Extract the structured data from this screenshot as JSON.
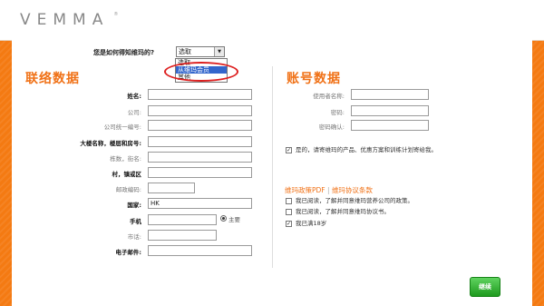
{
  "brand": {
    "logo_text": "VEMMA",
    "logo_mark": "®"
  },
  "question": {
    "label": "您是如何得知维玛的?",
    "selected": "选取",
    "options": [
      "选取",
      "从维玛会员",
      "其他"
    ],
    "highlighted_option": "从维玛会员"
  },
  "contact": {
    "title": "联络数据",
    "fields": [
      {
        "label": "姓名:",
        "value": ""
      },
      {
        "label": "公司:",
        "value": ""
      },
      {
        "label": "公司统一编号:",
        "value": ""
      },
      {
        "label": "大楼名称，楼层和房号:",
        "value": ""
      },
      {
        "label": "栋数，街名:",
        "value": ""
      },
      {
        "label": "村，镇或区",
        "value": ""
      },
      {
        "label": "邮政编码:",
        "value": ""
      },
      {
        "label": "国家:",
        "value": "HK"
      },
      {
        "label": "手机",
        "value": ""
      },
      {
        "label": "市话:",
        "value": ""
      },
      {
        "label": "电子邮件:",
        "value": ""
      }
    ],
    "primary_label": "主要"
  },
  "account": {
    "title": "账号数据",
    "fields": [
      {
        "label": "使用者名称:",
        "value": ""
      },
      {
        "label": "密码:",
        "value": ""
      },
      {
        "label": "密码确认:",
        "value": ""
      }
    ],
    "optin": {
      "checked": true,
      "text": "是的，请寄维玛的产品、优惠方案和训练计划寄给我。"
    }
  },
  "policies": {
    "link_pdf": "维玛政策PDF",
    "separator": "|",
    "link_terms": "维玛协议条款",
    "items": [
      {
        "checked": false,
        "text": "我已阅读，了解并同意维玛营养公司的政策。"
      },
      {
        "checked": false,
        "text": "我已阅读，了解并同意维玛协议书。"
      },
      {
        "checked": true,
        "text": "我已满18岁"
      }
    ]
  },
  "submit_label": "继续"
}
